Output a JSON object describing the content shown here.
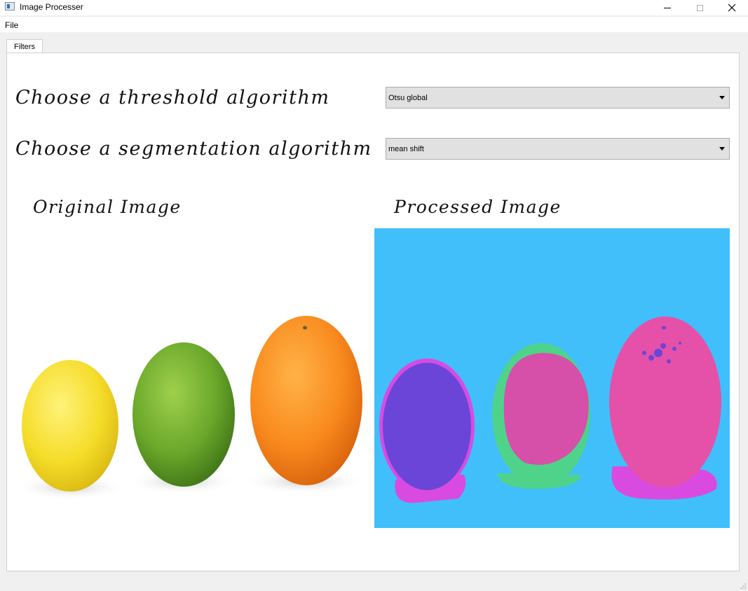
{
  "window": {
    "title": "Image Processer",
    "icon": "app-window-icon"
  },
  "menu": {
    "file": "File"
  },
  "tabs": [
    {
      "label": "Filters",
      "selected": true
    }
  ],
  "filters": {
    "threshold_label": "Choose a threshold algorithm",
    "threshold_value": "Otsu global",
    "segmentation_label": "Choose a segmentation algorithm",
    "segmentation_value": "mean shift",
    "original_label": "Original Image",
    "processed_label": "Processed Image"
  },
  "colors": {
    "processed_background": "#40bffb",
    "segment_purple": "#6b45d8",
    "segment_magenta": "#d64fa8",
    "segment_green": "#4fd38b",
    "segment_pink": "#e551a8",
    "lemon": "#f5e13a",
    "lime": "#6aa72a",
    "orange": "#f98a1e"
  }
}
